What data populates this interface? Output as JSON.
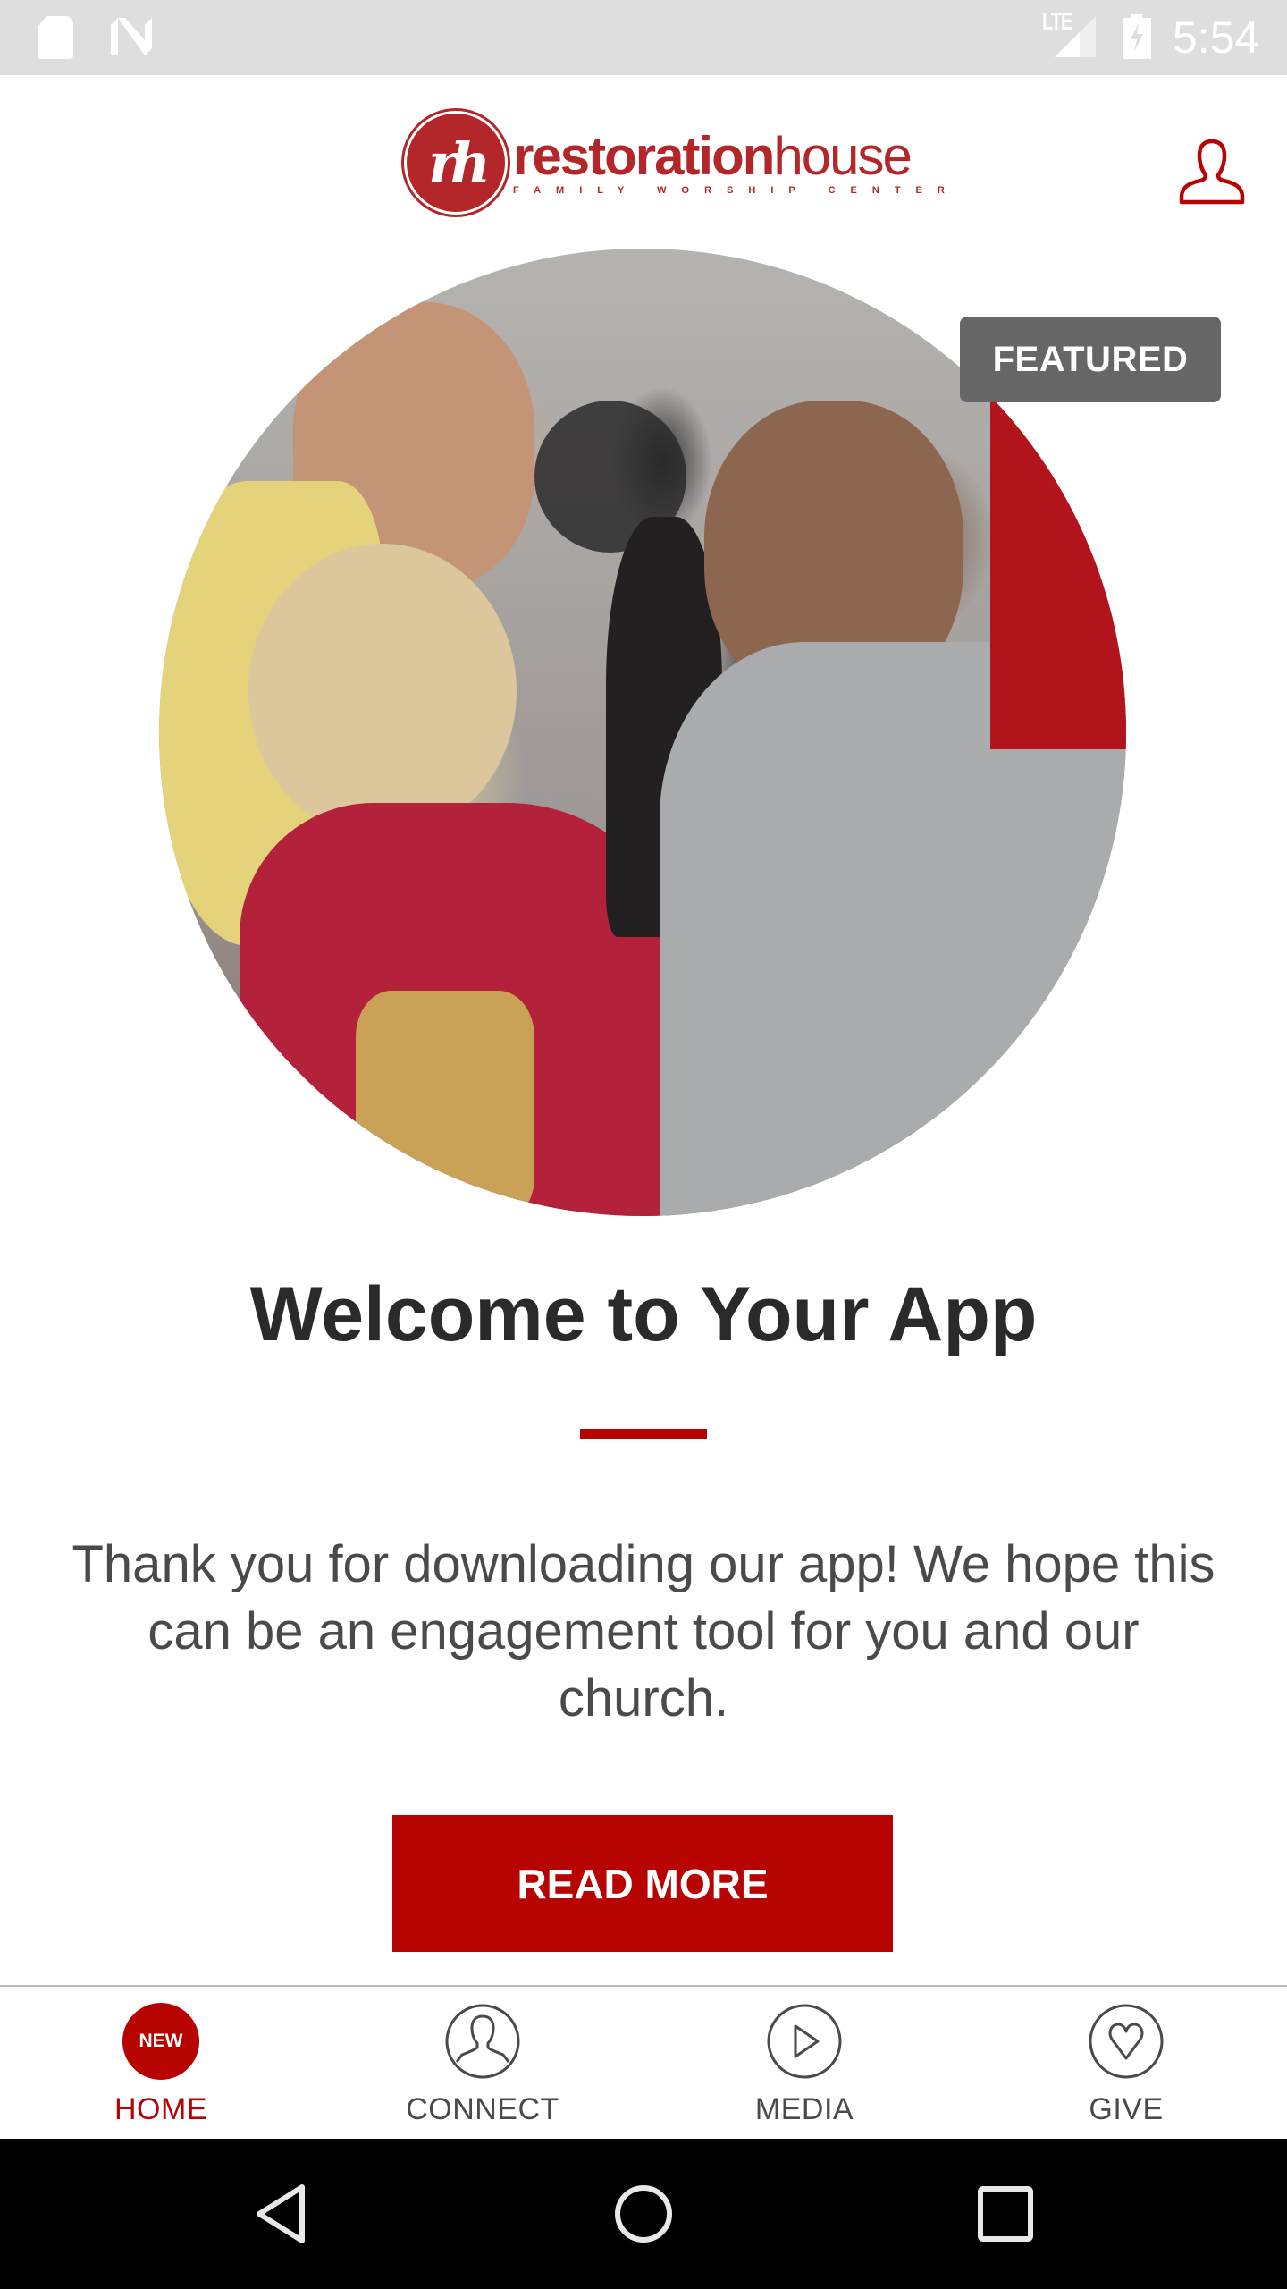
{
  "status_bar": {
    "time": "5:54",
    "network_label": "LTE",
    "icons": [
      "sd-card-icon",
      "n-notification-icon",
      "lte-signal-icon",
      "battery-charging-icon"
    ]
  },
  "header": {
    "logo": {
      "mark": "rh",
      "word_bold": "restoration",
      "word_light": "house",
      "tagline": "FAMILY WORSHIP CENTER"
    },
    "profile_icon": "person-outline-icon"
  },
  "hero": {
    "badge": "FEATURED",
    "image_alt": "Church members greeting one another"
  },
  "content": {
    "title": "Welcome to Your App",
    "body": "Thank you for downloading our app! We hope this can be an engagement tool for you and our church.",
    "button_label": "READ MORE"
  },
  "bottom_nav": {
    "items": [
      {
        "label": "HOME",
        "icon": "new-badge",
        "badge": "NEW",
        "active": true
      },
      {
        "label": "CONNECT",
        "icon": "person-circle-icon",
        "active": false
      },
      {
        "label": "MEDIA",
        "icon": "play-circle-icon",
        "active": false
      },
      {
        "label": "GIVE",
        "icon": "heart-circle-icon",
        "active": false
      }
    ]
  },
  "system_nav": {
    "buttons": [
      "back",
      "home",
      "recents"
    ]
  },
  "colors": {
    "accent": "#b80303",
    "logo_red": "#b3262a",
    "badge_gray": "#666666",
    "text_dark": "#2a2a2a",
    "text_body": "#4a4a4a",
    "status_bar": "#dedede"
  }
}
